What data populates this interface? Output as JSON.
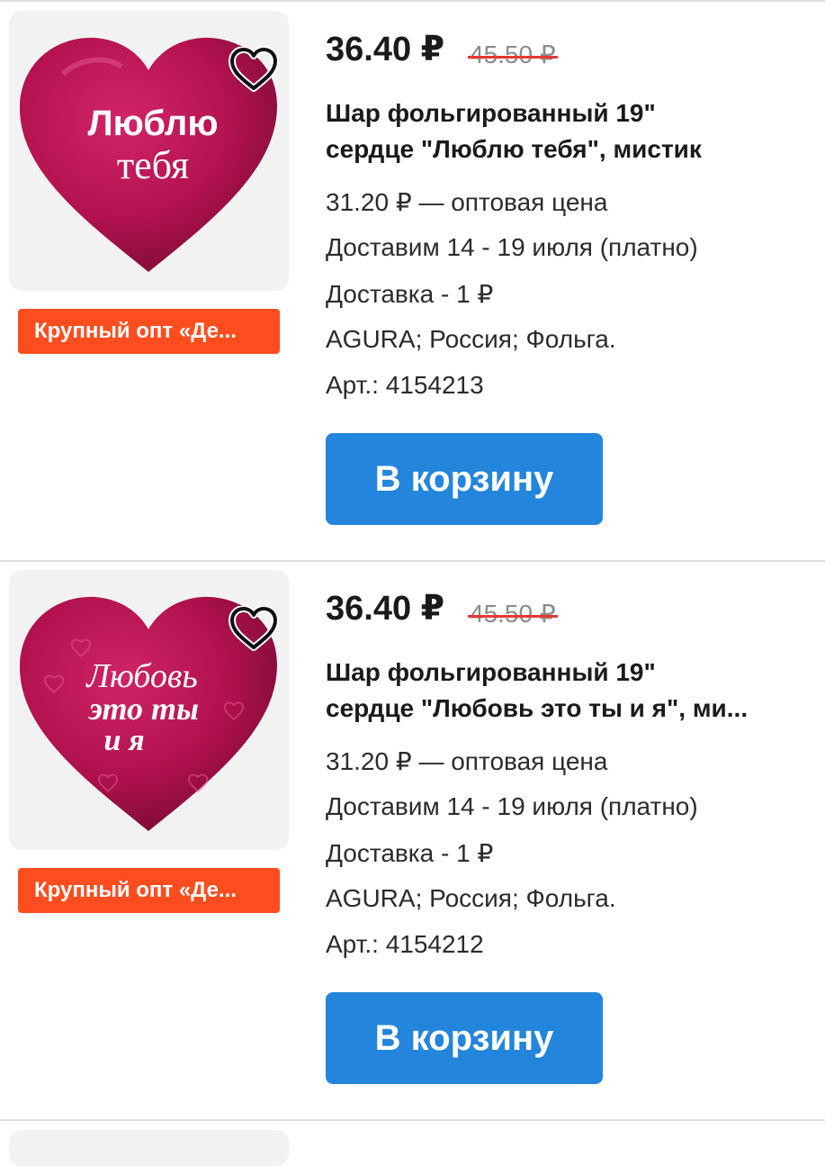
{
  "products": [
    {
      "image_alt": "Люблю тебя",
      "image_text": [
        "Люблю",
        "тебя"
      ],
      "favorite_icon": "heart-outline-icon",
      "promo_badge": "Крупный опт «Де...",
      "price": "36.40 ₽",
      "old_price": "45.50 ₽",
      "title_line1": "Шар фольгированный 19\"",
      "title_line2": "сердце \"Люблю тебя\", мистик",
      "wholesale_price": "31.20 ₽ — оптовая цена",
      "delivery_dates": "Доставим 14 - 19 июля (платно)",
      "delivery_cost": "Доставка - 1 ₽",
      "specs": "AGURA; Россия; Фольга.",
      "sku": "Арт.: 4154213",
      "cart_button": "В корзину"
    },
    {
      "image_alt": "Любовь это ты и я",
      "image_text": [
        "Любовь",
        "это ты",
        "и я"
      ],
      "favorite_icon": "heart-outline-icon",
      "promo_badge": "Крупный опт «Де...",
      "price": "36.40 ₽",
      "old_price": "45.50 ₽",
      "title_line1": "Шар фольгированный 19\"",
      "title_line2": "сердце \"Любовь это ты и я\", ми...",
      "wholesale_price": "31.20 ₽ — оптовая цена",
      "delivery_dates": "Доставим 14 - 19 июля (платно)",
      "delivery_cost": "Доставка - 1 ₽",
      "specs": "AGURA; Россия; Фольга.",
      "sku": "Арт.: 4154212",
      "cart_button": "В корзину"
    }
  ],
  "colors": {
    "price_strike": "#e53935",
    "badge": "#ff4d1f",
    "button": "#2385db",
    "balloon": "#b3124f"
  }
}
